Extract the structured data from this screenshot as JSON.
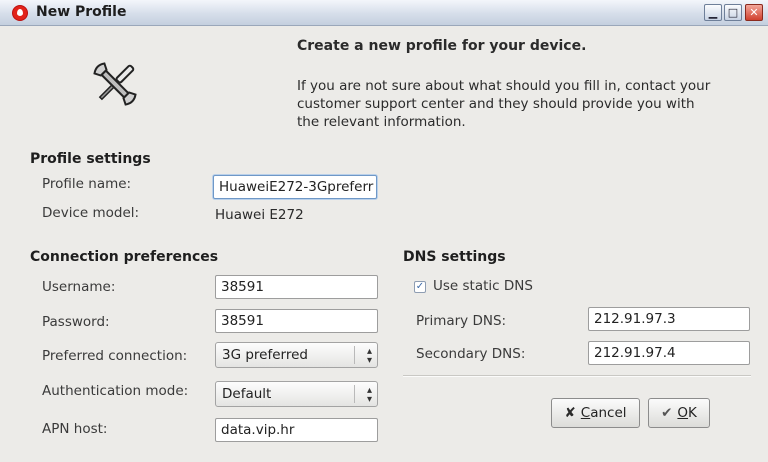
{
  "window": {
    "title": "New Profile",
    "controls": [
      "minimize",
      "maximize",
      "close"
    ]
  },
  "header": {
    "title": "Create a new profile for your device.",
    "description": "If you are not sure about what should you fill in, contact your customer support center and they should provide you with the relevant information.",
    "icon": "tools-icon"
  },
  "profile_settings": {
    "heading": "Profile settings",
    "profile_name_label": "Profile name:",
    "profile_name_value": "HuaweiE272-3Gpreferr",
    "device_model_label": "Device model:",
    "device_model_value": "Huawei E272"
  },
  "connection": {
    "heading": "Connection preferences",
    "username_label": "Username:",
    "username_value": "38591",
    "password_label": "Password:",
    "password_value": "38591",
    "preferred_label": "Preferred connection:",
    "preferred_value": "3G preferred",
    "auth_label": "Authentication mode:",
    "auth_value": "Default",
    "apn_label": "APN host:",
    "apn_value": "data.vip.hr"
  },
  "dns": {
    "heading": "DNS settings",
    "use_static_label": "Use static DNS",
    "use_static_checked": true,
    "primary_label": "Primary DNS:",
    "primary_value": "212.91.97.3",
    "secondary_label": "Secondary DNS:",
    "secondary_value": "212.91.97.4"
  },
  "buttons": {
    "cancel_prefix": "",
    "cancel_mnemonic": "C",
    "cancel_rest": "ancel",
    "ok_mnemonic": "O",
    "ok_rest": "K"
  }
}
